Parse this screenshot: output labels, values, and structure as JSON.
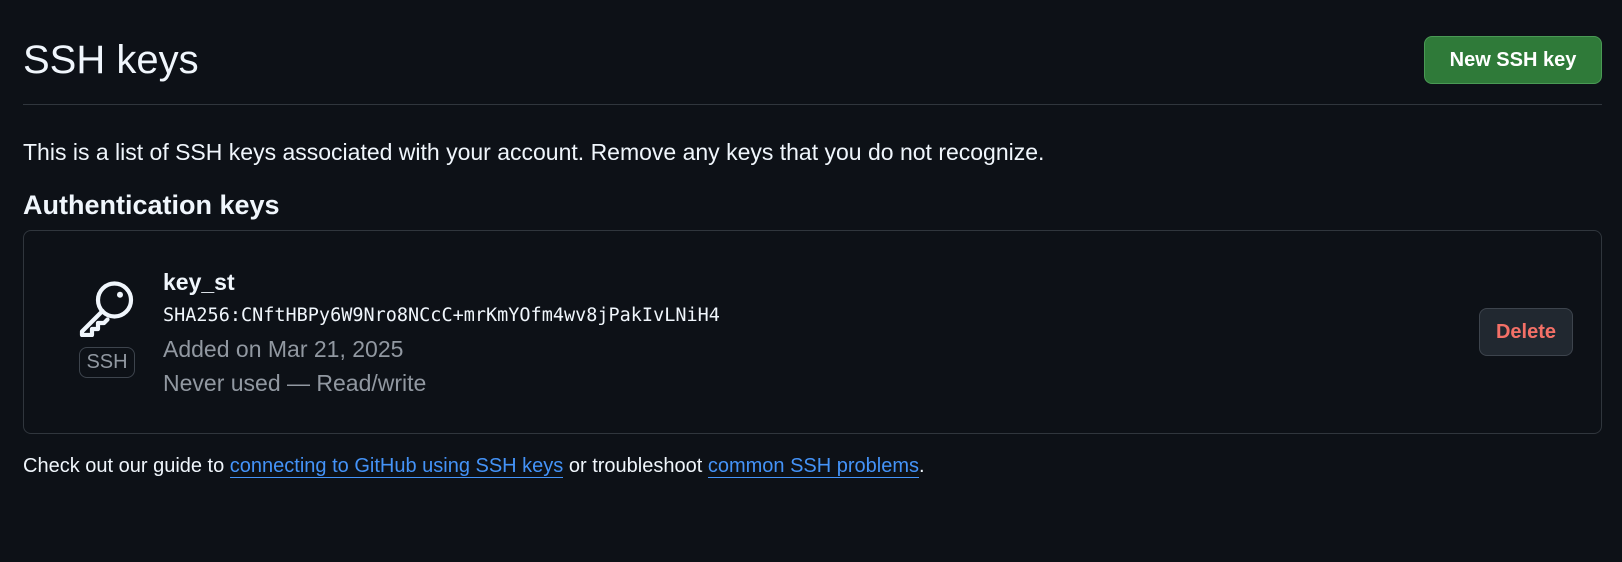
{
  "header": {
    "title": "SSH keys",
    "new_key_label": "New SSH key"
  },
  "description": "This is a list of SSH keys associated with your account. Remove any keys that you do not recognize.",
  "authentication_keys": {
    "heading": "Authentication keys",
    "keys": [
      {
        "icon": "key-icon",
        "badge": "SSH",
        "title": "key_st",
        "fingerprint": "SHA256:CNftHBPy6W9Nro8NCcC+mrKmYOfm4wv8jPakIvLNiH4",
        "added": "Added on Mar 21, 2025",
        "usage": "Never used — Read/write",
        "delete_label": "Delete"
      }
    ]
  },
  "footer": {
    "prefix": "Check out our guide to ",
    "link1": "connecting to GitHub using SSH keys",
    "middle": " or troubleshoot ",
    "link2": "common SSH problems",
    "suffix": "."
  },
  "colors": {
    "background": "#0d1117",
    "primary_button": "#2f7a39",
    "danger_text": "#f47067",
    "link": "#4493f8",
    "muted_text": "#9198a1",
    "border": "#30363d"
  }
}
